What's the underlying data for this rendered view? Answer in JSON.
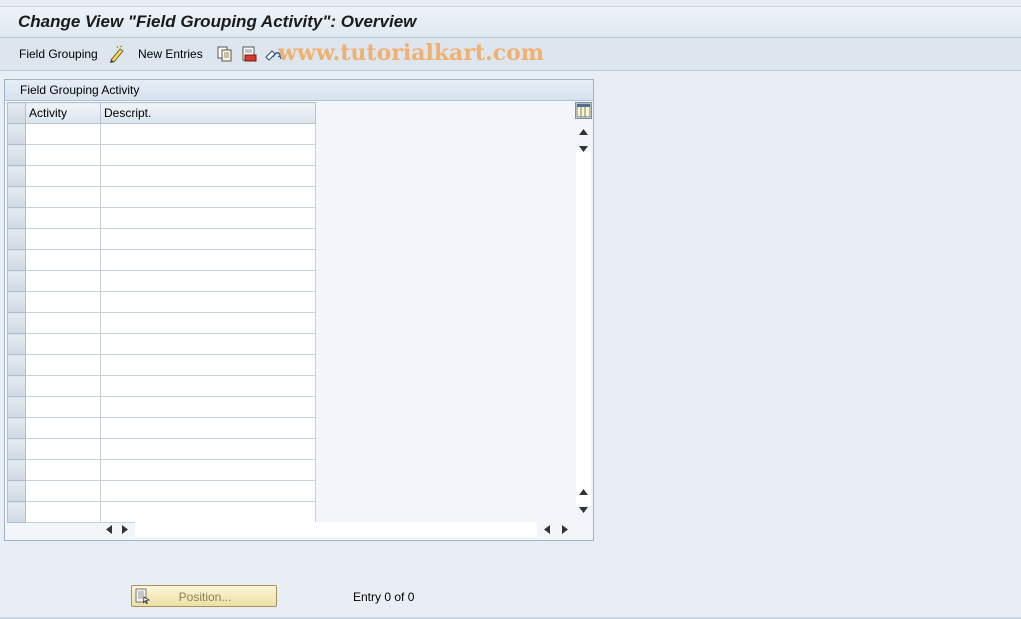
{
  "title": "Change View \"Field Grouping Activity\": Overview",
  "toolbar": {
    "field_grouping_label": "Field Grouping",
    "new_entries_label": "New Entries",
    "icons": [
      "display-change-icon",
      "copy-icon",
      "delete-icon",
      "undo-change-icon"
    ]
  },
  "watermark": "www.tutorialkart.com",
  "table": {
    "caption": "Field Grouping Activity",
    "columns": [
      "Activity",
      "Descript."
    ],
    "rows": [
      [
        "",
        ""
      ],
      [
        "",
        ""
      ],
      [
        "",
        ""
      ],
      [
        "",
        ""
      ],
      [
        "",
        ""
      ],
      [
        "",
        ""
      ],
      [
        "",
        ""
      ],
      [
        "",
        ""
      ],
      [
        "",
        ""
      ],
      [
        "",
        ""
      ],
      [
        "",
        ""
      ],
      [
        "",
        ""
      ],
      [
        "",
        ""
      ],
      [
        "",
        ""
      ],
      [
        "",
        ""
      ],
      [
        "",
        ""
      ],
      [
        "",
        ""
      ],
      [
        "",
        ""
      ],
      [
        "",
        ""
      ]
    ]
  },
  "footer": {
    "position_button_label": "Position...",
    "entry_text": "Entry 0 of 0"
  },
  "colors": {
    "background": "#e8eef4",
    "watermark": "#f0b070",
    "position_button": "#f5ebbd"
  }
}
